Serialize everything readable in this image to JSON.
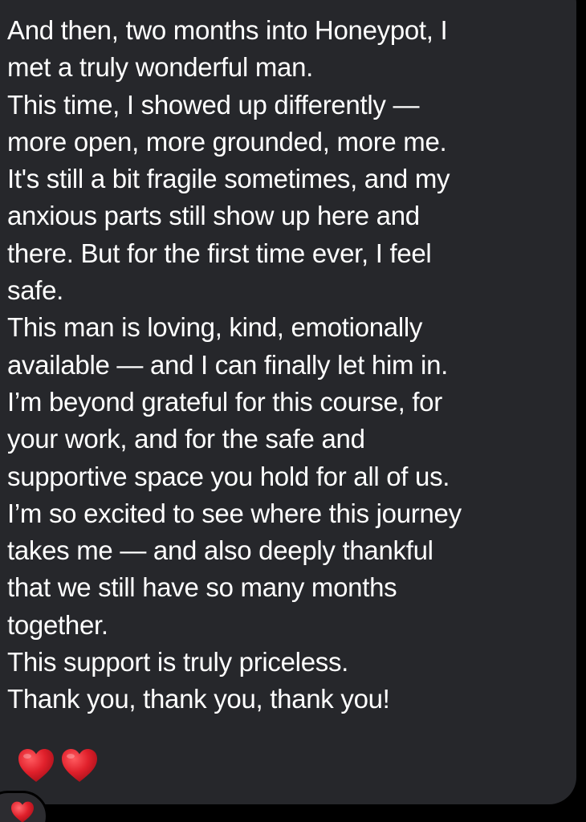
{
  "message": {
    "text": "And then, two months into Honeypot, I\nmet a truly wonderful man.\nThis time, I showed up differently —\nmore open, more grounded, more me.\nIt's still a bit fragile sometimes, and my\nanxious parts still show up here and\nthere. But for the first time ever, I feel\nsafe.\nThis man is loving, kind, emotionally\navailable — and I can finally let him in.\nI’m beyond grateful for this course, for\nyour work, and for the safe and\nsupportive space you hold for all of us.\nI’m so excited to see where this journey\ntakes me — and also deeply thankful\nthat we still have so many months\ntogether.\nThis support is truly priceless.\nThank you, thank you, thank you!",
    "emoji": [
      "red-heart",
      "red-heart"
    ],
    "bubble_color": "#26272b",
    "text_color": "#ffffff"
  },
  "reaction": {
    "emoji": "red-heart"
  },
  "colors": {
    "background": "#000000",
    "heart": "#e0202b"
  }
}
